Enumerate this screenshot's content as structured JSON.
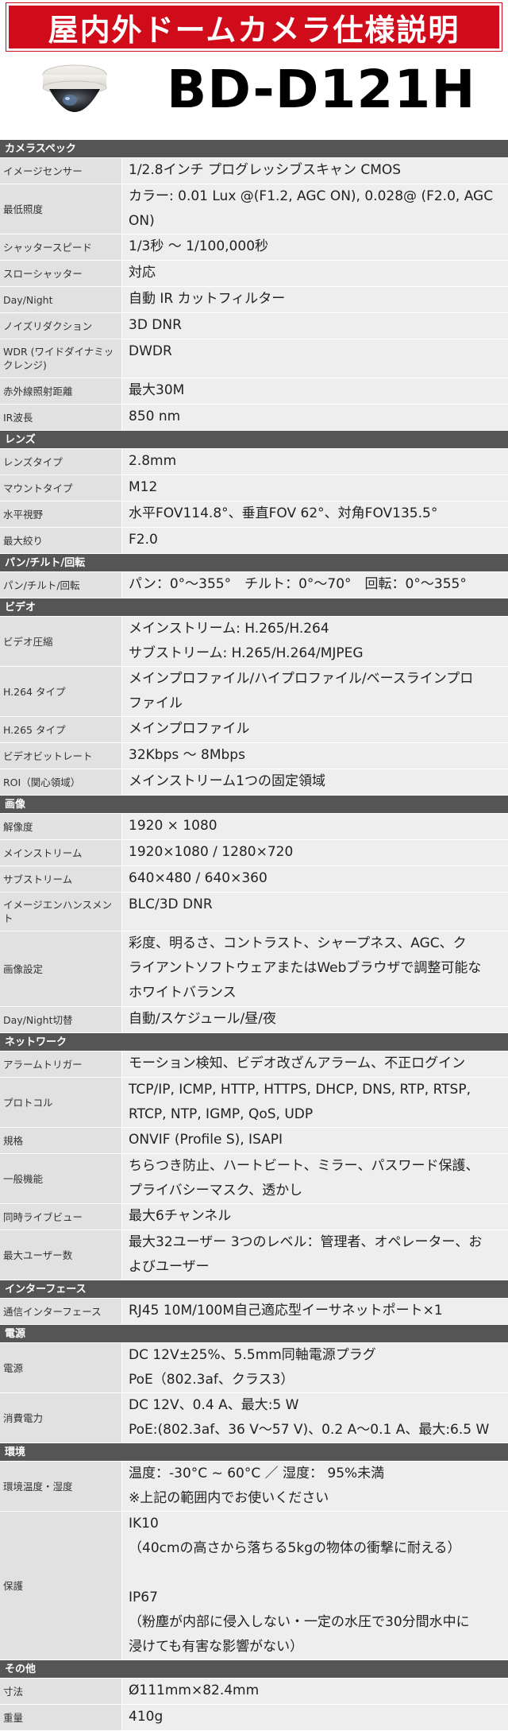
{
  "banner_title": "屋内外ドームカメラ仕様説明",
  "model": "BD-D121H",
  "sections": [
    {
      "title": "カメラスペック",
      "rows": [
        {
          "label": "イメージセンサー",
          "value": "1/2.8インチ プログレッシブスキャン CMOS",
          "h": 32
        },
        {
          "label": "最低照度",
          "value": "カラー: 0.01 Lux @(F1.2, AGC ON), 0.028@ (F2.0, AGC\nON)",
          "h": 62
        },
        {
          "label": "シャッタースピード",
          "value": "1/3秒 〜 1/100,000秒",
          "h": 32
        },
        {
          "label": "スローシャッター",
          "value": "対応",
          "h": 32
        },
        {
          "label": "Day/Night",
          "value": "自動 IR カットフィルター",
          "h": 32
        },
        {
          "label": "ノイズリダクション",
          "value": "3D DNR",
          "h": 32
        },
        {
          "label": "WDR (ワイドダイナミックレンジ)",
          "value": "DWDR",
          "h": 48
        },
        {
          "label": "赤外線照射距離",
          "value": "最大30M",
          "h": 32
        },
        {
          "label": "IR波長",
          "value": "850 nm",
          "h": 32
        }
      ]
    },
    {
      "title": "レンズ",
      "rows": [
        {
          "label": "レンズタイプ",
          "value": "2.8mm",
          "h": 32
        },
        {
          "label": "マウントタイプ",
          "value": "M12",
          "h": 32
        },
        {
          "label": "水平視野",
          "value": "水平FOV114.8°、垂直FOV 62°、対角FOV135.5°",
          "h": 32
        },
        {
          "label": "最大絞り",
          "value": "F2.0",
          "h": 32
        }
      ]
    },
    {
      "title": "パン/チルト/回転",
      "rows": [
        {
          "label": "パン/チルト/回転",
          "value": "パン：0°～355°　チルト：0°～70°　回転：0°～355°",
          "h": 32
        }
      ]
    },
    {
      "title": "ビデオ",
      "rows": [
        {
          "label": "ビデオ圧縮",
          "value": "メインストリーム: H.265/H.264\nサブストリーム: H.265/H.264/MJPEG",
          "h": 62
        },
        {
          "label": "H.264 タイプ",
          "value": "メインプロファイル/ハイプロファイル/ベースラインプロ\nファイル",
          "h": 62
        },
        {
          "label": "H.265 タイプ",
          "value": "メインプロファイル",
          "h": 32
        },
        {
          "label": "ビデオビットレート",
          "value": "32Kbps 〜 8Mbps",
          "h": 32
        },
        {
          "label": "ROI（関心領域）",
          "value": "メインストリーム1つの固定領域",
          "h": 32
        }
      ]
    },
    {
      "title": "画像",
      "rows": [
        {
          "label": "解像度",
          "value": "1920 × 1080",
          "h": 32
        },
        {
          "label": "メインストリーム",
          "value": "1920×1080 / 1280×720",
          "h": 32
        },
        {
          "label": "サブストリーム",
          "value": "640×480 / 640×360",
          "h": 32
        },
        {
          "label": "イメージエンハンスメント",
          "value": "BLC/3D DNR",
          "h": 48
        },
        {
          "label": "画像設定",
          "value": "彩度、明るさ、コントラスト、シャープネス、AGC、ク\nライアントソフトウェアまたはWebブラウザで調整可能な\nホワイトバランス",
          "h": 94
        },
        {
          "label": "Day/Night切替",
          "value": "自動/スケジュール/昼/夜",
          "h": 32
        }
      ]
    },
    {
      "title": "ネットワーク",
      "rows": [
        {
          "label": "アラームトリガー",
          "value": "モーション検知、ビデオ改ざんアラーム、不正ログイン",
          "h": 32
        },
        {
          "label": "プロトコル",
          "value": "TCP/IP, ICMP, HTTP, HTTPS, DHCP, DNS, RTP, RTSP,\nRTCP, NTP, IGMP, QoS, UDP",
          "h": 62
        },
        {
          "label": "規格",
          "value": "ONVIF (Profile S), ISAPI",
          "h": 32
        },
        {
          "label": "一般機能",
          "value": "ちらつき防止、ハートビート、ミラー、パスワード保護、\nプライバシーマスク、透かし",
          "h": 62
        },
        {
          "label": "同時ライブビュー",
          "value": "最大6チャンネル",
          "h": 32
        },
        {
          "label": "最大ユーザー数",
          "value": "最大32ユーザー 3つのレベル：管理者、オペレーター、お\nよびユーザー",
          "h": 62
        }
      ]
    },
    {
      "title": "インターフェース",
      "rows": [
        {
          "label": "通信インターフェース",
          "value": "RJ45 10M/100M自己適応型イーサネットポート×1",
          "h": 32
        }
      ]
    },
    {
      "title": "電源",
      "rows": [
        {
          "label": "電源",
          "value": "DC 12V±25%、5.5mm同軸電源プラグ\nPoE（802.3af、クラス3）",
          "h": 62
        },
        {
          "label": "消費電力",
          "value": "DC 12V、0.4 A、最大:5 W\nPoE:(802.3af、36 V〜57 V)、0.2 A〜0.1 A、最大:6.5 W",
          "h": 62
        }
      ]
    },
    {
      "title": "環境",
      "rows": [
        {
          "label": "環境温度・湿度",
          "value": "温度：-30°C ~ 60°C ／ 湿度： 95%未満\n※上記の範囲内でお使いください",
          "h": 62
        },
        {
          "label": "保護",
          "value": "IK10\n（40cmの高さから落ちる5kgの物体の衝撃に耐える）\n\nIP67\n（粉塵が内部に侵入しない・一定の水圧で30分間水中に\n浸けても有害な影響がない）",
          "h": 186
        }
      ]
    },
    {
      "title": "その他",
      "rows": [
        {
          "label": "寸法",
          "value": "Ø111mm×82.4mm",
          "h": 32
        },
        {
          "label": "重量",
          "value": "410g",
          "h": 32
        }
      ]
    }
  ]
}
